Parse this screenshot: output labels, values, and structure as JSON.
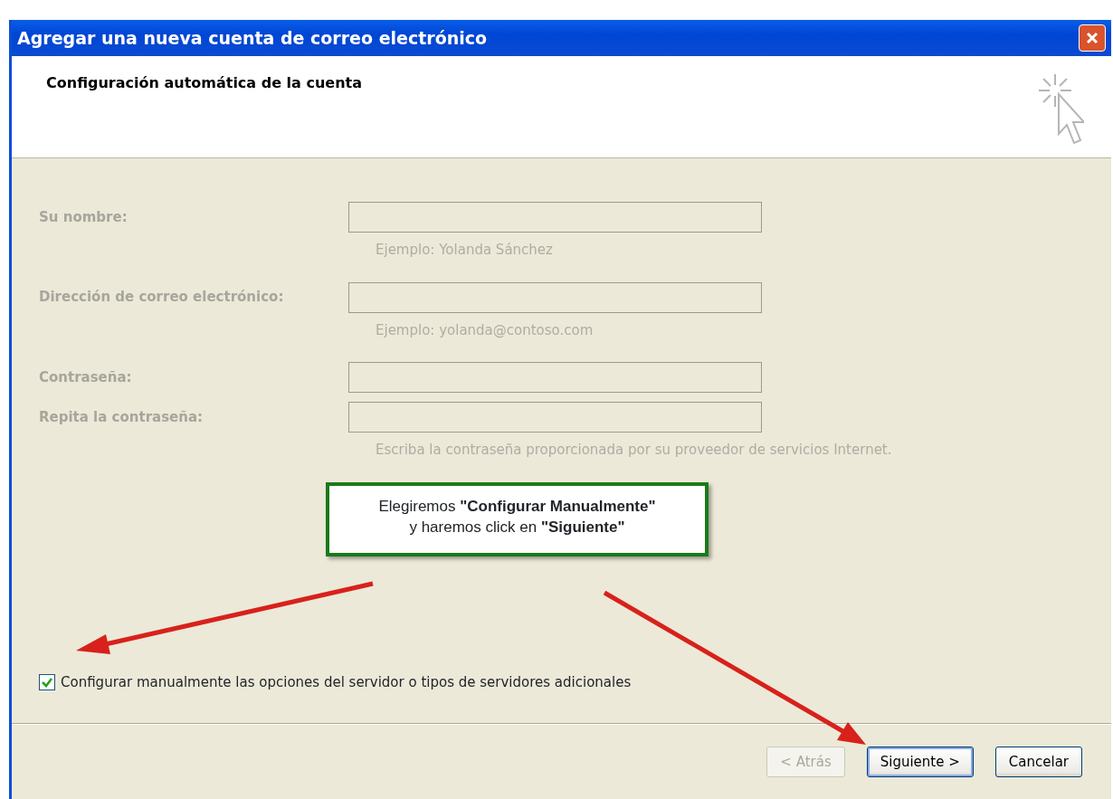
{
  "window": {
    "title": "Agregar una nueva cuenta de correo electrónico"
  },
  "header": {
    "title": "Configuración automática de la cuenta"
  },
  "fields": [
    {
      "label": "Su nombre:",
      "hint": "Ejemplo: Yolanda Sánchez",
      "disabled": true
    },
    {
      "label": "Dirección de correo electrónico:",
      "hint": "Ejemplo: yolanda@contoso.com",
      "disabled": true
    },
    {
      "label": "Contraseña:",
      "disabled": true
    },
    {
      "label": "Repita la contraseña:",
      "hint": "Escriba la contraseña proporcionada por su proveedor de servicios Internet.",
      "disabled": true
    }
  ],
  "callout": {
    "lines": [
      "Elegiremos **\"Configurar Manualmente\"**",
      "y haremos click en **\"Siguiente\"**"
    ]
  },
  "checkbox": {
    "label": "Configurar manualmente las opciones del servidor o tipos de servidores adicionales",
    "checked": true
  },
  "buttons": [
    {
      "label": "< Atrás",
      "disabled": true,
      "default": false
    },
    {
      "label": "Siguiente >",
      "disabled": false,
      "default": true
    },
    {
      "label": "Cancelar",
      "disabled": false,
      "default": false
    }
  ]
}
